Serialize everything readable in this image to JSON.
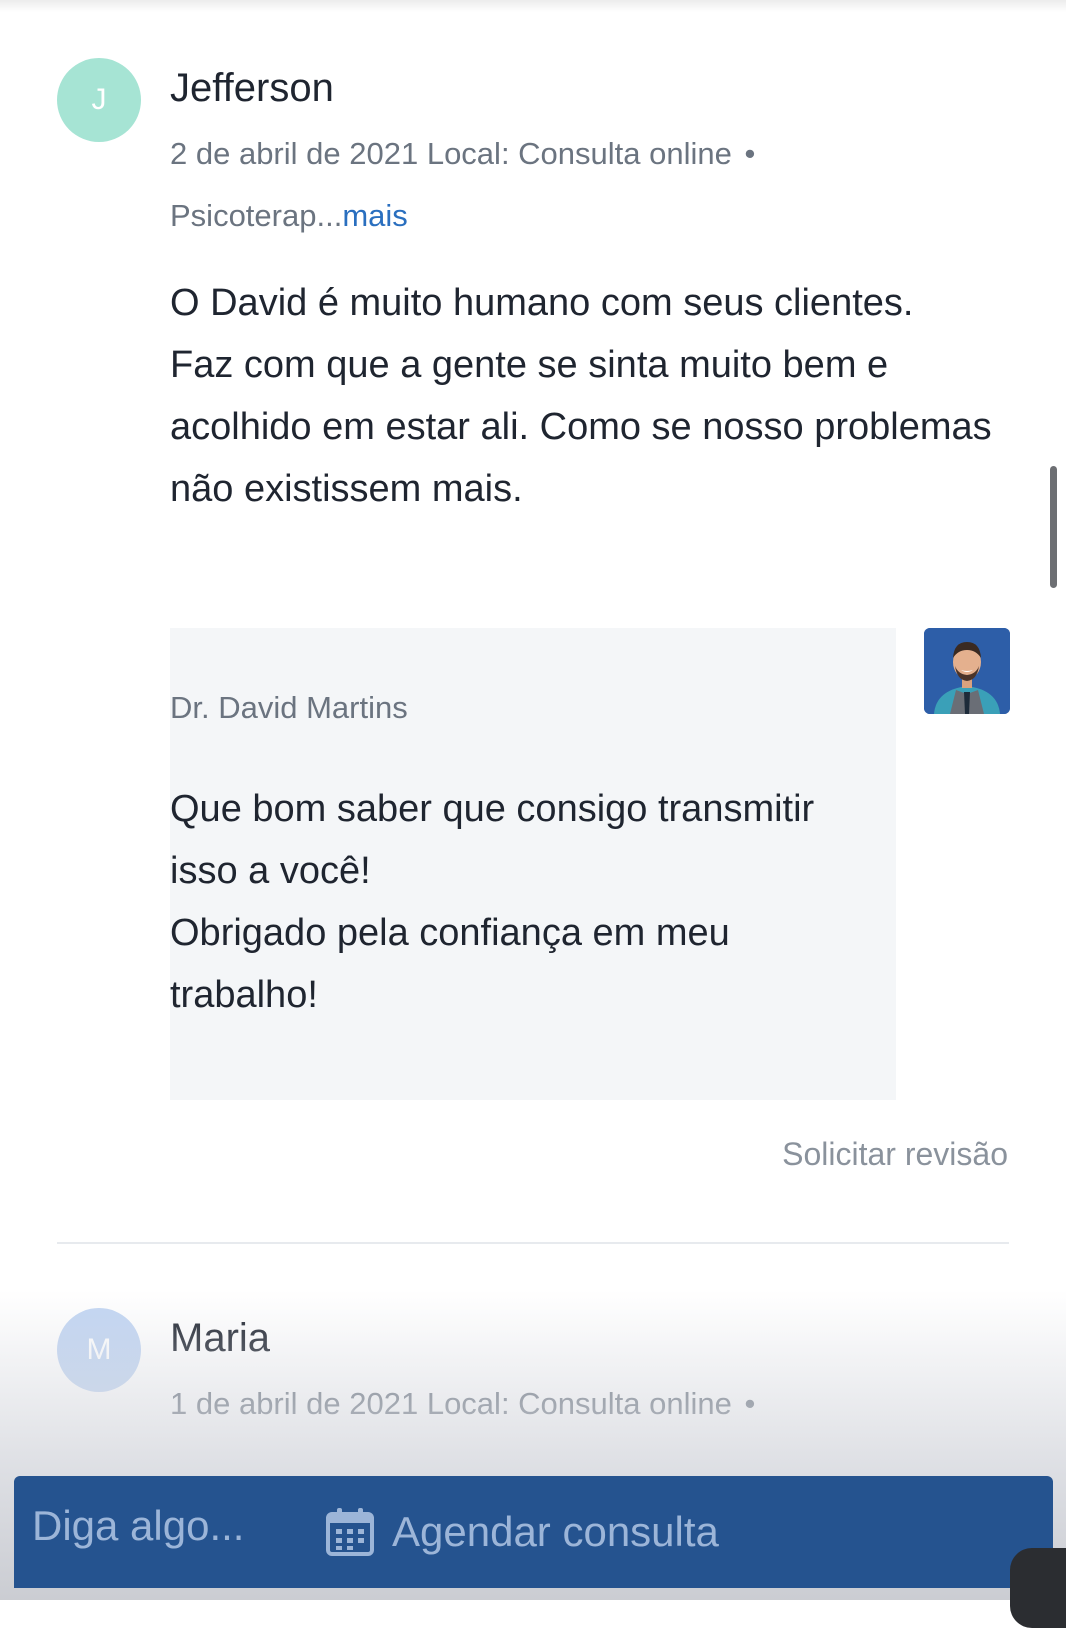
{
  "reviews": [
    {
      "initial": "J",
      "author": "Jefferson",
      "date": "2 de abril de 2021",
      "location": "Local: Consulta online",
      "bullet": "•",
      "service_truncated": "Psicoterap...",
      "more_label": "mais",
      "body": [
        "O David é muito humano com seus clientes.",
        "Faz com que a gente se sinta muito bem e acolhido em estar ali. Como se nosso problemas não existissem mais."
      ],
      "reply": {
        "author": "Dr. David Martins",
        "body": [
          "Que bom saber que consigo transmitir isso a você!",
          "Obrigado pela confiança em meu trabalho!"
        ]
      },
      "request_review_label": "Solicitar revisão"
    },
    {
      "initial": "M",
      "author": "Maria",
      "date": "1 de abril de 2021",
      "location": "Local: Consulta online",
      "bullet": "•"
    }
  ],
  "action_bar": {
    "input_placeholder": "Diga algo...",
    "book_label": "Agendar consulta",
    "book_icon": "calendar-icon"
  },
  "colors": {
    "accent_link": "#2a6fbf",
    "action_bar": "#25538f",
    "avatar_j": "#a6e4d4",
    "avatar_m": "#c2d6f3",
    "reply_bg": "#f4f6f8"
  }
}
